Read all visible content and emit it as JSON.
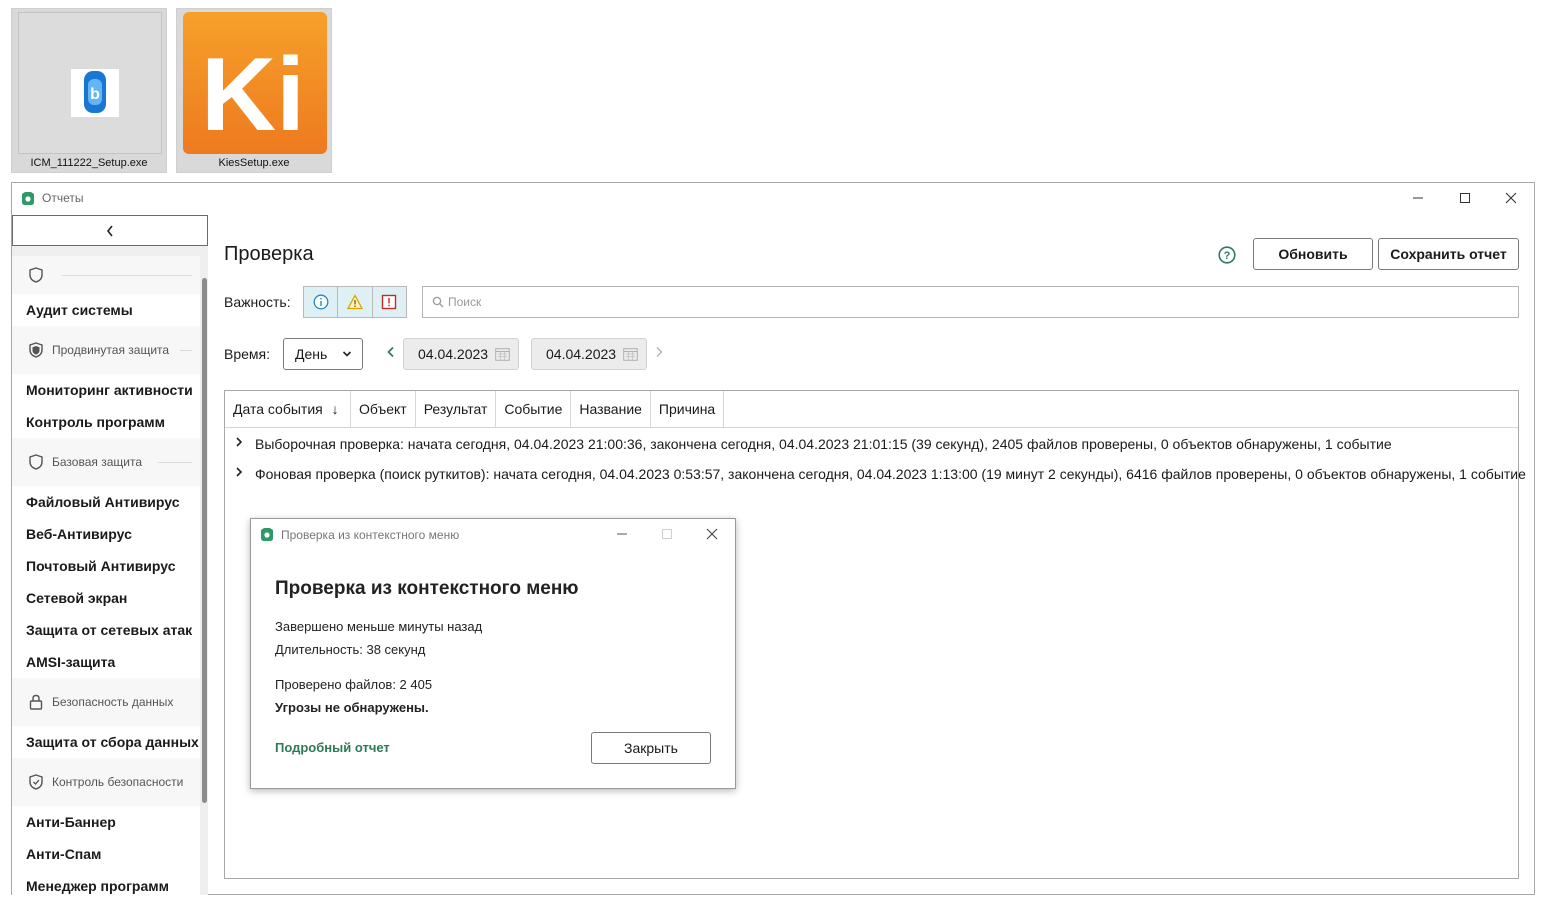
{
  "desktop": {
    "icons": [
      {
        "name": "ICM_111222_Setup.exe"
      },
      {
        "name": "KiesSetup.exe",
        "glyph": "Ki"
      }
    ]
  },
  "window": {
    "title": "Отчеты",
    "accent": "#2e7a5a"
  },
  "sidebar": {
    "items_top": [
      "Аудит системы"
    ],
    "groups": [
      {
        "label": "Продвинутая защита",
        "items": [
          "Мониторинг активности",
          "Контроль программ"
        ]
      },
      {
        "label": "Базовая защита",
        "items": [
          "Файловый Антивирус",
          "Веб-Антивирус",
          "Почтовый Антивирус",
          "Сетевой экран",
          "Защита от сетевых атак",
          "AMSI-защита"
        ]
      },
      {
        "label": "Безопасность данных",
        "items": [
          "Защита от сбора данных"
        ]
      },
      {
        "label": "Контроль безопасности",
        "items": [
          "Анти-Баннер",
          "Анти-Спам",
          "Менеджер программ"
        ]
      }
    ]
  },
  "main": {
    "title": "Проверка",
    "refresh_label": "Обновить",
    "save_label": "Сохранить отчет",
    "severity_label": "Важность:",
    "search_placeholder": "Поиск",
    "time_label": "Время:",
    "period_value": "День",
    "date_from": "04.04.2023",
    "date_to": "04.04.2023",
    "columns": [
      "Дата события",
      "Объект",
      "Результат",
      "Событие",
      "Название",
      "Причина"
    ],
    "sort_indicator": "↓",
    "rows": [
      "Выборочная проверка: начата сегодня, 04.04.2023 21:00:36, закончена сегодня, 04.04.2023 21:01:15 (39 секунд), 2405 файлов проверены, 0 объектов обнаружены, 1 событие",
      "Фоновая проверка (поиск руткитов): начата сегодня, 04.04.2023 0:53:57, закончена сегодня, 04.04.2023 1:13:00 (19 минут 2 секунды), 6416 файлов проверены, 0 объектов обнаружены, 1 событие"
    ]
  },
  "dialog": {
    "title": "Проверка из контекстного меню",
    "heading": "Проверка из контекстного меню",
    "completed": "Завершено меньше минуты назад",
    "duration": "Длительность: 38 секунд",
    "files_checked": "Проверено файлов: 2 405",
    "threats": "Угрозы не обнаружены.",
    "report_link": "Подробный отчет",
    "close_label": "Закрыть"
  }
}
